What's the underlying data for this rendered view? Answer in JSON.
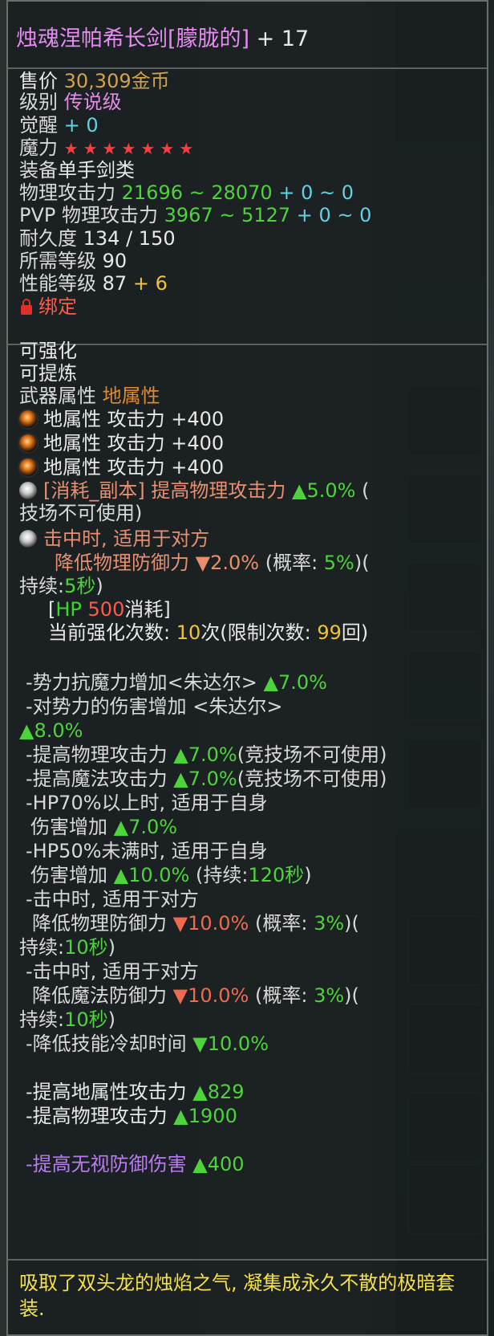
{
  "title": {
    "name": "烛魂涅帕希长剑[朦胧的]",
    "plus": " + 17"
  },
  "basic": {
    "price_label": "售价",
    "price_value": "30,309金币",
    "grade_label": "级别",
    "grade_value": "传说级",
    "awaken_label": "觉醒",
    "awaken_value": "+ 0",
    "magic_label": "魔力",
    "magic_stars": "★★★★★★★",
    "equip_label": "装备",
    "equip_value": "单手剑类",
    "phys_label": "物理攻击力",
    "phys_value": "21696 ~ 28070",
    "phys_bonus": " + 0 ~ 0",
    "pvp_label": "PVP 物理攻击力",
    "pvp_value": "3967 ~ 5127",
    "pvp_bonus": " + 0 ~ 0",
    "dur_label": "耐久度",
    "dur_value": "134 / 150",
    "req_label": "所需等级",
    "req_value": "90",
    "perf_label": "性能等级",
    "perf_value": "87",
    "perf_bonus": "+ 6",
    "bind_label": "绑定"
  },
  "props": {
    "l1": "可强化",
    "l2": "可提炼",
    "attr_label": "武器属性 ",
    "attr_value": "地属性",
    "orb1": "地属性 攻击力 +400",
    "orb2": "地属性 攻击力 +400",
    "orb3": "地属性 攻击力 +400",
    "cons_a": "[消耗_副本] 提高物理攻击力 ",
    "cons_b": "▲5.0%",
    "cons_c": "(",
    "cons_d": "技场不可使用)",
    "hit_a": "击中时, 适用于对方",
    "hit_b": "降低物理防御力 ▼2.0%",
    "hit_c": "(概率: ",
    "hit_d": "5%",
    "hit_e": ")(",
    "dur_a": "持续:",
    "dur_b": "5秒",
    "dur_c": ")",
    "hp_a": "[",
    "hp_b": "HP ",
    "hp_c": "500",
    "hp_d": "消耗]",
    "enh_a": "当前强化次数: ",
    "enh_b": "10",
    "enh_c": "次(限制次数: ",
    "enh_d": "99",
    "enh_e": "回)"
  },
  "set": {
    "s1a": "-势力抗魔力增加<朱达尔> ",
    "s1b": "▲7.0%",
    "s2": "-对势力的伤害增加 <朱达尔>",
    "s3": "▲8.0%",
    "s4a": "-提高物理攻击力 ",
    "s4b": "▲7.0%",
    "s4c": "(竞技场不可使用)",
    "s5a": "-提高魔法攻击力 ",
    "s5b": "▲7.0%",
    "s5c": "(竞技场不可使用)",
    "s6": "-HP70%以上时, 适用于自身",
    "s7a": "伤害增加 ",
    "s7b": "▲7.0%",
    "s8": "-HP50%未满时, 适用于自身",
    "s9a": "伤害增加 ",
    "s9b": "▲10.0%",
    "s9c": " (持续:",
    "s9d": "120秒",
    "s9e": ")",
    "s10": "-击中时, 适用于对方",
    "s11a": "降低物理防御力 ",
    "s11b": "▼10.0%",
    "s11c": " (概率: ",
    "s11d": "3%",
    "s11e": ")(",
    "s12a": "持续:",
    "s12b": "10秒",
    "s12c": ")",
    "s13": "-击中时, 适用于对方",
    "s14a": "降低魔法防御力 ",
    "s14b": "▼10.0%",
    "s14c": " (概率: ",
    "s14d": "3%",
    "s14e": ")(",
    "s15a": "持续:",
    "s15b": "10秒",
    "s15c": ")",
    "s16a": "-降低技能冷却时间 ",
    "s16b": "▼10.0%",
    "s17a": "-提高地属性攻击力 ",
    "s17b": "▲829",
    "s18a": "-提高物理攻击力 ",
    "s18b": "▲1900",
    "s19a": "-提高无视防御伤害 ",
    "s19b": "▲400"
  },
  "description": "吸取了双头龙的烛焰之气, 凝集成永久不散的极暗套装."
}
